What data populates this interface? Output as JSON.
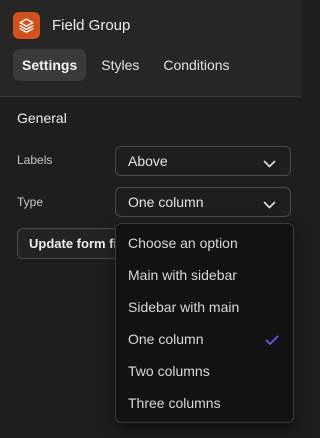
{
  "header": {
    "title": "Field Group",
    "icon": "layers-icon",
    "icon_color": "#d2501c"
  },
  "tabs": [
    {
      "label": "Settings",
      "active": true
    },
    {
      "label": "Styles",
      "active": false
    },
    {
      "label": "Conditions",
      "active": false
    }
  ],
  "section": {
    "title": "General"
  },
  "labels_field": {
    "label": "Labels",
    "value": "Above"
  },
  "type_field": {
    "label": "Type",
    "value": "One column",
    "options": [
      "Choose an option",
      "Main with sidebar",
      "Sidebar with main",
      "One column",
      "Two columns",
      "Three columns"
    ],
    "selected_index": 3,
    "check_color": "#6c5ce7"
  },
  "update_button": {
    "label": "Update form fields"
  }
}
